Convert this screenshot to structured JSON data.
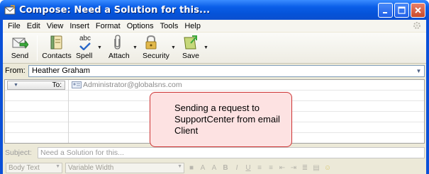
{
  "window": {
    "title": "Compose: Need a Solution for this..."
  },
  "menu": [
    "File",
    "Edit",
    "View",
    "Insert",
    "Format",
    "Options",
    "Tools",
    "Help"
  ],
  "toolbar": {
    "send": "Send",
    "contacts": "Contacts",
    "spell": "Spell",
    "spell_icon_text": "abc",
    "attach": "Attach",
    "security": "Security",
    "save": "Save"
  },
  "from": {
    "label": "From:",
    "value": "Heather Graham"
  },
  "recipients": {
    "type": "To:",
    "address": "Administrator@globalsns.com"
  },
  "subject": {
    "label": "Subject:",
    "value": "Need a Solution for this..."
  },
  "format": {
    "paragraph": "Body Text",
    "font": "Variable Width"
  },
  "callout": {
    "text": "Sending a request to SupportCenter from email Client"
  },
  "colors": {
    "titlebar": "#0a5ee8",
    "callout_bg": "#fde2e2",
    "callout_border": "#cc3333"
  }
}
